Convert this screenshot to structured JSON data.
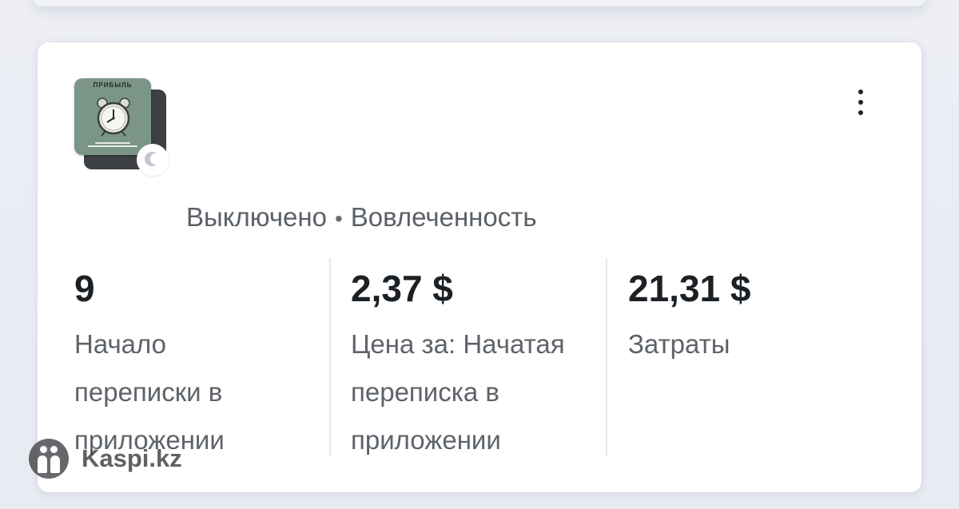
{
  "status": {
    "state": "Выключено",
    "separator": "•",
    "goal": "Вовлеченность"
  },
  "thumbnail": {
    "title": "ПРИБЫЛЬ",
    "badge_icon": "meta-logo-icon"
  },
  "menu": {
    "icon": "more-vertical-icon"
  },
  "metrics": [
    {
      "value": "9",
      "label_lines": [
        "Начало",
        "переписки в",
        "приложении"
      ]
    },
    {
      "value": "2,37 $",
      "label_lines": [
        "Цена за: Начатая",
        "переписка в",
        "приложении"
      ]
    },
    {
      "value": "21,31 $",
      "label_lines": [
        "Затраты"
      ]
    }
  ],
  "watermark": {
    "text": "Kaspi.kz"
  }
}
